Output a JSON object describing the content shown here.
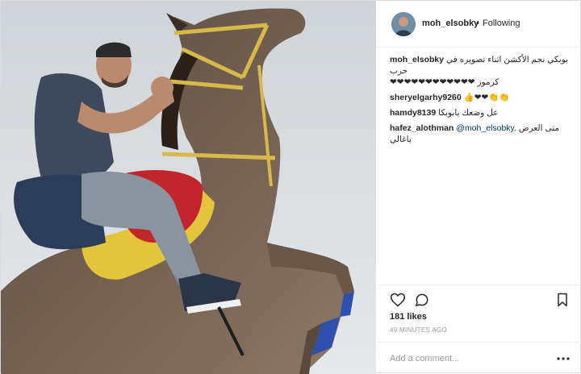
{
  "post": {
    "header": {
      "username": "moh_elsobky",
      "separator": "•",
      "follow_status": "Following",
      "avatar_icon": "avatar-photo"
    },
    "comments": [
      {
        "user": "moh_elsobky",
        "text": "بوبكي نجم الأكشن اثناء تصويره في حرب",
        "text2": "كرموز ❤❤❤❤❤❤❤❤❤❤❤❤"
      },
      {
        "user": "sheryelgarhy9260",
        "text": "👍❤❤👏👏"
      },
      {
        "user": "hamdy8139",
        "text": "عل وضعك يابوبكا"
      },
      {
        "user": "hafez_alothman",
        "mention": "@moh_elsobky.",
        "text": "متى العرض",
        "text2": "ياغالي"
      }
    ],
    "actions": {
      "like_icon": "heart-icon",
      "comment_icon": "comment-bubble-icon",
      "save_icon": "bookmark-icon"
    },
    "likes": "181 likes",
    "time": "49 MINUTES AGO",
    "add_comment": {
      "placeholder": "Add a comment...",
      "more_icon": "more-options-icon"
    }
  },
  "colors": {
    "border": "#dbdbdb",
    "text": "#262626",
    "muted": "#999999",
    "mention": "#003569"
  }
}
